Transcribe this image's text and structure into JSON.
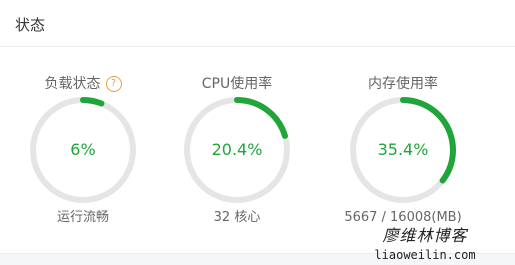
{
  "panel": {
    "title": "状态"
  },
  "colors": {
    "accent": "#20a53a",
    "track": "#e5e5e5",
    "help": "#e6a23c"
  },
  "gauges": [
    {
      "label": "负载状态",
      "value_text": "6%",
      "percent": 6,
      "sub": "运行流畅",
      "has_help": true,
      "help_glyph": "?"
    },
    {
      "label": "CPU使用率",
      "value_text": "20.4%",
      "percent": 20.4,
      "sub": "32 核心"
    },
    {
      "label": "内存使用率",
      "value_text": "35.4%",
      "percent": 35.4,
      "sub": "5667 / 16008(MB)"
    }
  ],
  "watermark": {
    "name": "廖维林博客",
    "url": "liaoweilin.com"
  }
}
